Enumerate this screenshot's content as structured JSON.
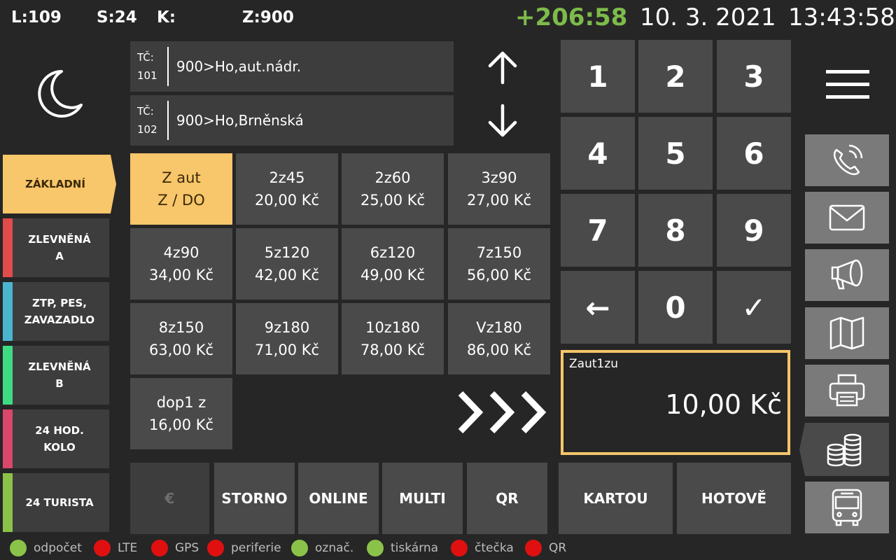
{
  "topbar": {
    "l": "L:109",
    "s": "S:24",
    "k": "K:",
    "z": "Z:900",
    "delay": "+206:58",
    "date": "10. 3. 2021",
    "time": "13:43:58",
    "delay_color": "#7dbb4a"
  },
  "categories": [
    {
      "label": "ZÁKLADNÍ",
      "stripe": "#f8c66b",
      "active": true
    },
    {
      "label": "ZLEVNĚNÁ\nA",
      "stripe": "#e24b4b"
    },
    {
      "label": "ZTP, PES,\nZAVAZADLO",
      "stripe": "#4bb5cf"
    },
    {
      "label": "ZLEVNĚNÁ\nB",
      "stripe": "#3ddc84"
    },
    {
      "label": "24 HOD.\nKOLO",
      "stripe": "#d9476b"
    },
    {
      "label": "24 TURISTA",
      "stripe": "#8bc34a"
    }
  ],
  "stops": [
    {
      "tc": "TČ:\n101",
      "name": "900>Ho,aut.nádr."
    },
    {
      "tc": "TČ:\n102",
      "name": "900>Ho,Brněnská"
    }
  ],
  "fares": [
    {
      "line1": "Z aut",
      "line2": "Z / DO",
      "active": true
    },
    {
      "line1": "2z45",
      "line2": "20,00 Kč"
    },
    {
      "line1": "2z60",
      "line2": "25,00 Kč"
    },
    {
      "line1": "3z90",
      "line2": "27,00 Kč"
    },
    {
      "line1": "4z90",
      "line2": "34,00 Kč"
    },
    {
      "line1": "5z120",
      "line2": "42,00 Kč"
    },
    {
      "line1": "6z120",
      "line2": "49,00 Kč"
    },
    {
      "line1": "7z150",
      "line2": "56,00 Kč"
    },
    {
      "line1": "8z150",
      "line2": "63,00 Kč"
    },
    {
      "line1": "9z180",
      "line2": "71,00 Kč"
    },
    {
      "line1": "10z180",
      "line2": "78,00 Kč"
    },
    {
      "line1": "Vz180",
      "line2": "86,00 Kč"
    },
    {
      "line1": "dop1 z",
      "line2": "16,00 Kč"
    }
  ],
  "keypad": [
    "1",
    "2",
    "3",
    "4",
    "5",
    "6",
    "7",
    "8",
    "9",
    "←",
    "0",
    "✓"
  ],
  "summary": {
    "label": "Zaut1zu",
    "amount": "10,00 Kč",
    "border_color": "#f8c66b"
  },
  "bottom": {
    "euro": "€",
    "storno": "STORNO",
    "online": "ONLINE",
    "multi": "MULTI",
    "qr": "QR",
    "kartou": "KARTOU",
    "hotove": "HOTOVĚ"
  },
  "side_icons": [
    "phone-icon",
    "mail-icon",
    "megaphone-icon",
    "map-icon",
    "printer-icon",
    "coins-icon",
    "bus-icon"
  ],
  "status": [
    {
      "label": "odpočet",
      "color": "#8bc34a"
    },
    {
      "label": "LTE",
      "color": "#e01010"
    },
    {
      "label": "GPS",
      "color": "#e01010"
    },
    {
      "label": "periferie",
      "color": "#e01010"
    },
    {
      "label": "označ.",
      "color": "#8bc34a"
    },
    {
      "label": "tiskárna",
      "color": "#8bc34a"
    },
    {
      "label": "čtečka",
      "color": "#e01010"
    },
    {
      "label": "QR",
      "color": "#e01010"
    }
  ]
}
